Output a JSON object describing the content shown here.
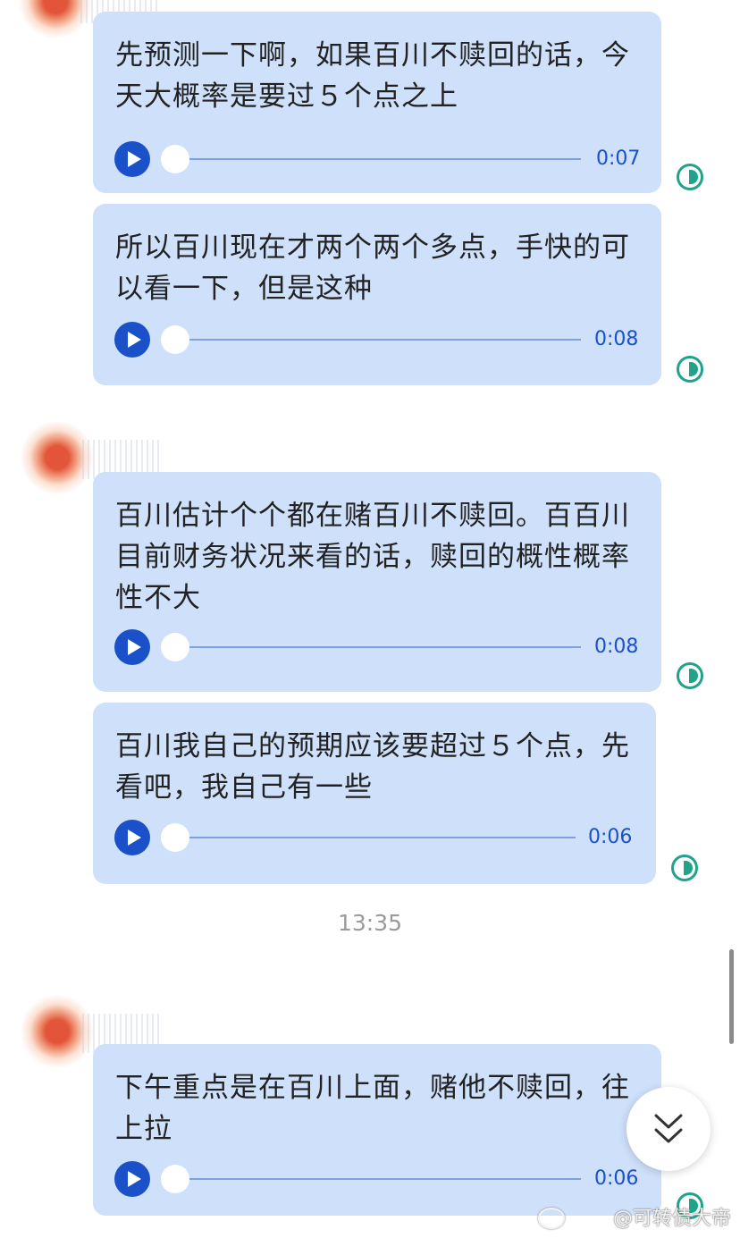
{
  "messages": [
    {
      "text": "先预测一下啊，如果百川不赎回的话，今天大概率是要过５个点之上",
      "duration": "0:07"
    },
    {
      "text": "所以百川现在才两个两个多点，手快的可以看一下，但是这种",
      "duration": "0:08"
    },
    {
      "text": "百川估计个个都在赌百川不赎回。百百川目前财务状况来看的话，赎回的概性概率性不大",
      "duration": "0:08"
    },
    {
      "text": "百川我自己的预期应该要超过５个点，先看吧，我自己有一些",
      "duration": "0:06"
    },
    {
      "text": "下午重点是在百川上面，赌他不赎回，往上拉",
      "duration": "0:06"
    }
  ],
  "timestamp": "13:35",
  "watermark": "@可转债大帝",
  "icons": {
    "play": "play-icon",
    "status": "half-circle-icon",
    "scroll_down": "double-chevron-down-icon",
    "watermark_logo": "weibo-icon"
  },
  "colors": {
    "bubble": "#cfe0fb",
    "accent": "#1a50c8",
    "status": "#1fa38a"
  }
}
